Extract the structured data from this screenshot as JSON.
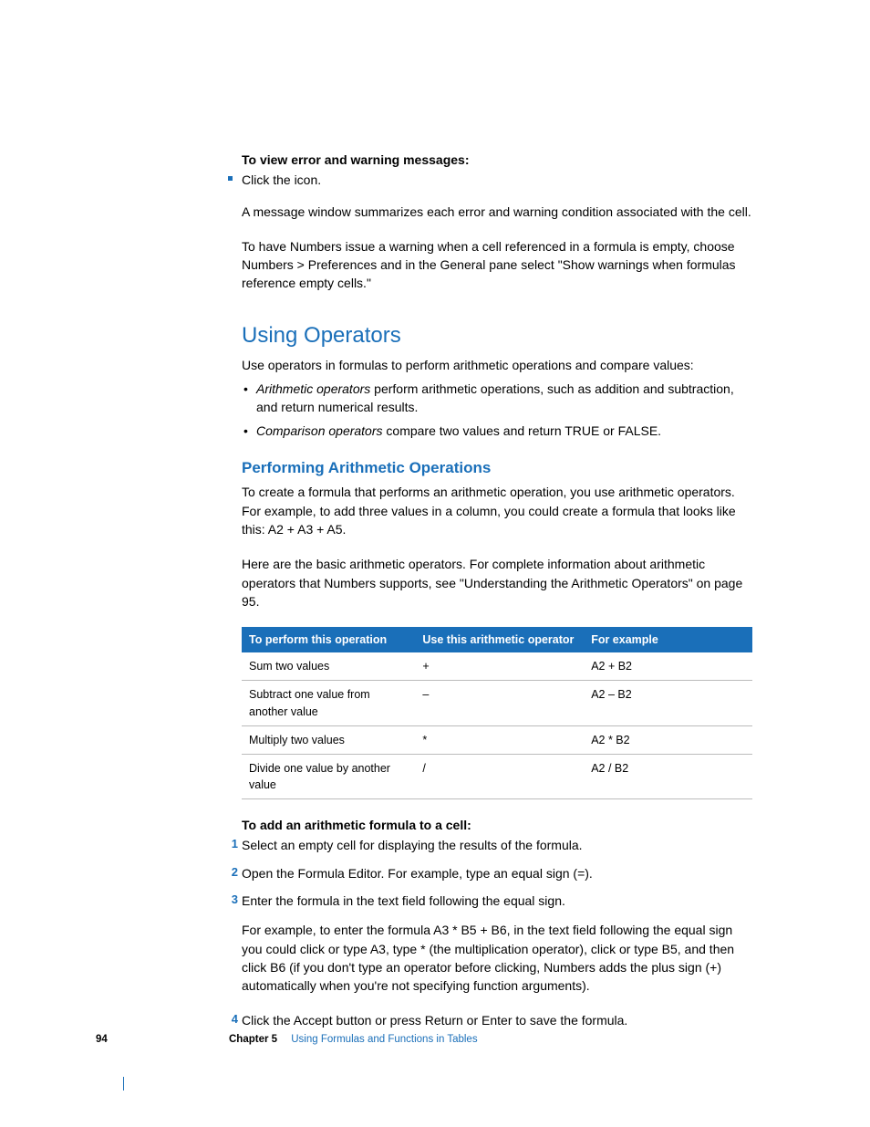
{
  "section1": {
    "heading": "To view error and warning messages:",
    "bullet": "Click the icon.",
    "p1": "A message window summarizes each error and warning condition associated with the cell.",
    "p2": "To have Numbers issue a warning when a cell referenced in a formula is empty, choose Numbers > Preferences and in the General pane select \"Show warnings when formulas reference empty cells.\""
  },
  "operators": {
    "title": "Using Operators",
    "intro": "Use operators in formulas to perform arithmetic operations and compare values:",
    "bullets": [
      {
        "em": "Arithmetic operators",
        "rest": " perform arithmetic operations, such as addition and subtraction, and return numerical results."
      },
      {
        "em": "Comparison operators",
        "rest": " compare two values and return TRUE or FALSE."
      }
    ]
  },
  "arith": {
    "title": "Performing Arithmetic Operations",
    "p1": "To create a formula that performs an arithmetic operation, you use arithmetic operators. For example, to add three values in a column, you could create a formula that looks like this:  A2 + A3 + A5.",
    "p2": "Here are the basic arithmetic operators. For complete information about arithmetic operators that Numbers supports, see \"Understanding the Arithmetic Operators\" on page 95."
  },
  "table": {
    "headers": [
      "To perform this operation",
      "Use this arithmetic operator",
      "For example"
    ],
    "rows": [
      [
        "Sum two values",
        "+",
        "A2 + B2"
      ],
      [
        "Subtract one value from another value",
        "–",
        "A2 – B2"
      ],
      [
        "Multiply two values",
        "*",
        "A2 * B2"
      ],
      [
        "Divide one value by another value",
        "/",
        "A2 / B2"
      ]
    ]
  },
  "steps": {
    "heading": "To add an arithmetic formula to a cell:",
    "items": [
      "Select an empty cell for displaying the results of the formula.",
      "Open the Formula Editor. For example, type an equal sign (=).",
      "Enter the formula in the text field following the equal sign.",
      "Click the Accept button or press Return or Enter to save the formula."
    ],
    "step3_extra": "For example, to enter the formula A3 * B5 + B6, in the text field following the equal sign you could click or type A3, type * (the multiplication operator), click or type B5, and then click B6 (if you don't type an operator before clicking, Numbers adds the plus sign (+) automatically when you're not specifying function arguments)."
  },
  "footer": {
    "page": "94",
    "chapter": "Chapter 5",
    "title": "Using Formulas and Functions in Tables"
  }
}
